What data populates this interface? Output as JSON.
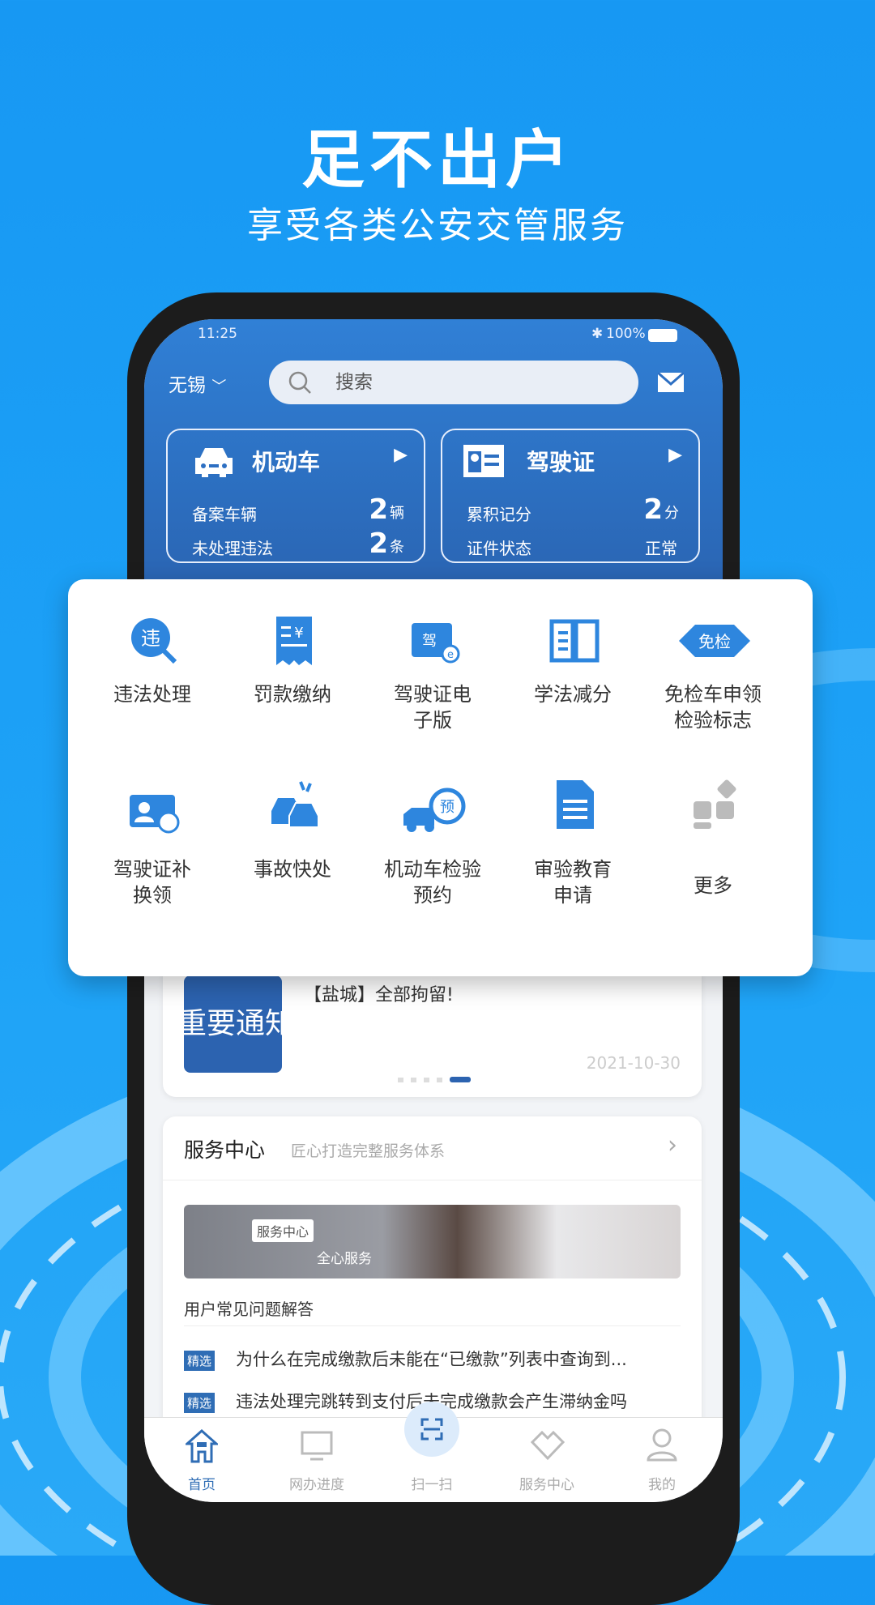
{
  "hero": {
    "title": "足不出户",
    "subtitle": "享受各类公安交管服务"
  },
  "status_bar": {
    "time": "11:25",
    "battery": "100%"
  },
  "header": {
    "city": "无锡",
    "search_placeholder": "搜索"
  },
  "vehicle_card": {
    "title": "机动车",
    "rows": [
      {
        "label": "备案车辆",
        "value": "2",
        "unit": "辆"
      },
      {
        "label": "未处理违法",
        "value": "2",
        "unit": "条"
      }
    ]
  },
  "license_card": {
    "title": "驾驶证",
    "rows": [
      {
        "label": "累积记分",
        "value": "2",
        "unit": "分"
      },
      {
        "label": "证件状态",
        "value": "正常"
      }
    ]
  },
  "services": [
    {
      "label": "违法处理",
      "icon": "violation-search-icon"
    },
    {
      "label": "罚款缴纳",
      "icon": "receipt-icon"
    },
    {
      "label": "驾驶证电子版",
      "icon": "e-license-icon"
    },
    {
      "label": "学法减分",
      "icon": "book-icon"
    },
    {
      "label": "免检车申领检验标志",
      "icon": "exempt-badge-icon",
      "badge_text": "免检"
    },
    {
      "label": "驾驶证补换领",
      "icon": "license-renew-icon"
    },
    {
      "label": "事故快处",
      "icon": "accident-icon"
    },
    {
      "label": "机动车检验预约",
      "icon": "inspection-booking-icon",
      "badge_text": "预"
    },
    {
      "label": "审验教育申请",
      "icon": "document-icon"
    },
    {
      "label": "更多",
      "icon": "more-grid-icon"
    }
  ],
  "news": {
    "image_text": "重要通知",
    "title": "【盐城】全部拘留!",
    "date": "2021-10-30",
    "slides": 5,
    "active_slide": 5
  },
  "service_center": {
    "title": "服务中心",
    "subtitle": "匠心打造完整服务体系",
    "banner_tag": "服务中心",
    "banner_text": "全心服务",
    "faq_title": "用户常见问题解答",
    "faqs": [
      {
        "tag": "精选",
        "text": "为什么在完成缴款后未能在“已缴款”列表中查询到..."
      },
      {
        "tag": "精选",
        "text": "违法处理完跳转到支付后未完成缴款会产生滞纳金吗"
      }
    ]
  },
  "tabbar": [
    {
      "label": "首页",
      "active": true
    },
    {
      "label": "网办进度"
    },
    {
      "label": "扫一扫"
    },
    {
      "label": "服务中心"
    },
    {
      "label": "我的"
    }
  ],
  "colors": {
    "background": "#1a9cf5",
    "header": "#2d6fc2",
    "accent": "#2f6db5",
    "icon": "#2e86de"
  }
}
